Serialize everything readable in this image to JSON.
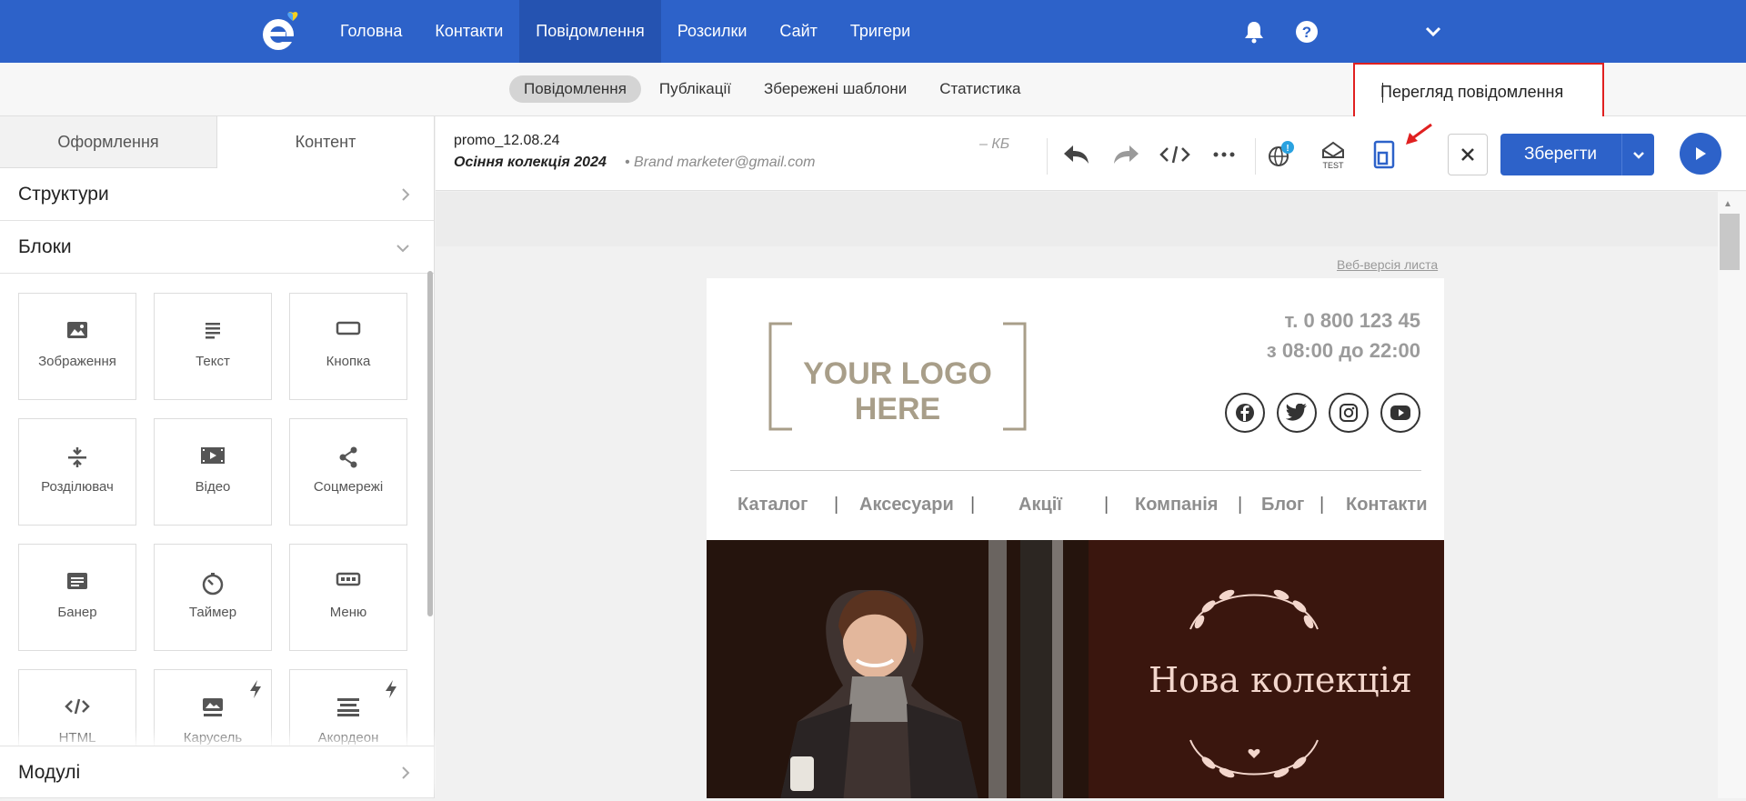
{
  "nav": {
    "items": [
      "Головна",
      "Контакти",
      "Повідомлення",
      "Розсилки",
      "Сайт",
      "Тригери"
    ],
    "active": "Повідомлення"
  },
  "topbar_icons": [
    "bell-icon",
    "help-icon",
    "chevron-down-icon"
  ],
  "subnav": {
    "items": [
      "Повідомлення",
      "Публікації",
      "Збережені шаблони",
      "Статистика"
    ],
    "active": "Повідомлення"
  },
  "tooltip": {
    "text": "Перегляд повідомлення"
  },
  "left_panel": {
    "tabs": [
      "Оформлення",
      "Контент"
    ],
    "active_tab": "Контент",
    "sections": {
      "structures": "Структури",
      "blocks": "Блоки",
      "modules": "Модулі"
    },
    "blocks": [
      {
        "label": "Зображення",
        "icon": "image-icon"
      },
      {
        "label": "Текст",
        "icon": "text-icon"
      },
      {
        "label": "Кнопка",
        "icon": "button-icon"
      },
      {
        "label": "Розділювач",
        "icon": "divider-icon"
      },
      {
        "label": "Відео",
        "icon": "video-icon"
      },
      {
        "label": "Соцмережі",
        "icon": "share-icon"
      },
      {
        "label": "Банер",
        "icon": "banner-icon"
      },
      {
        "label": "Таймер",
        "icon": "timer-icon"
      },
      {
        "label": "Меню",
        "icon": "menu-icon"
      },
      {
        "label": "HTML",
        "icon": "code-icon"
      },
      {
        "label": "Карусель",
        "icon": "carousel-icon"
      },
      {
        "label": "Акордеон",
        "icon": "accordion-icon"
      }
    ]
  },
  "editor": {
    "file_name": "promo_12.08.24",
    "subject": "Осіння колекція 2024",
    "sender": "• Brand marketer@gmail.com",
    "size": "– КБ",
    "save_label": "Зберегти",
    "notification_badge": "!"
  },
  "email": {
    "web_version": "Веб-версія листа",
    "logo_text": "YOUR LOGO HERE",
    "phone": "т. 0 800 123 45",
    "hours": "з 08:00 до 22:00",
    "menu": [
      "Каталог",
      "Аксесуари",
      "Акції",
      "Компанія",
      "Блог",
      "Контакти"
    ],
    "banner_title": "Нова колекція",
    "socials": [
      "facebook-icon",
      "twitter-icon",
      "instagram-icon",
      "youtube-icon"
    ]
  },
  "colors": {
    "primary": "#2d62c9",
    "highlight": "#e02020",
    "banner_bg": "#3a160e",
    "banner_text": "#f3d6cc"
  }
}
